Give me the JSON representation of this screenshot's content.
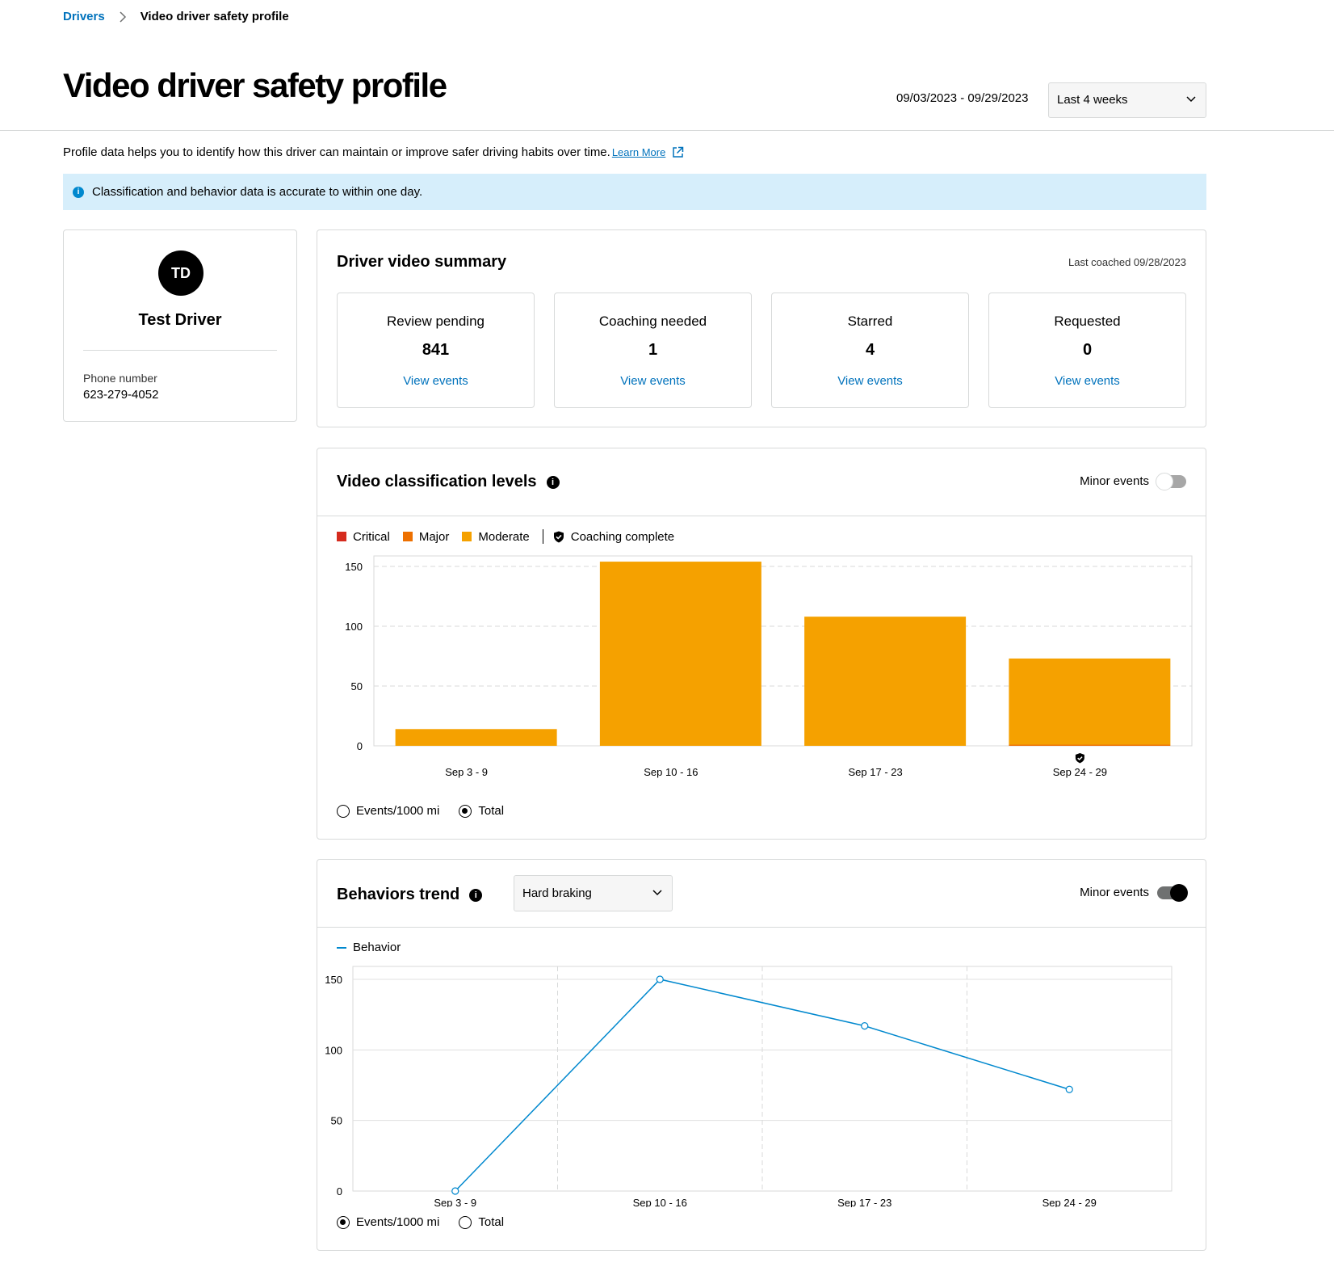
{
  "breadcrumb": {
    "parent": "Drivers",
    "current": "Video driver safety profile"
  },
  "header": {
    "title": "Video driver safety profile",
    "date_range": "09/03/2023 - 09/29/2023",
    "range_select": "Last 4 weeks"
  },
  "description": {
    "text": "Profile data helps you to identify how this driver can maintain or improve safer driving habits over time.",
    "link": "Learn More"
  },
  "banner": {
    "text": "Classification and behavior data is accurate to within one day."
  },
  "driver": {
    "initials": "TD",
    "name": "Test Driver",
    "phone_label": "Phone number",
    "phone": "623-279-4052"
  },
  "summary": {
    "title": "Driver video summary",
    "last_coached": "Last coached 09/28/2023",
    "tiles": [
      {
        "label": "Review pending",
        "value": "841",
        "link": "View events"
      },
      {
        "label": "Coaching needed",
        "value": "1",
        "link": "View events"
      },
      {
        "label": "Starred",
        "value": "4",
        "link": "View events"
      },
      {
        "label": "Requested",
        "value": "0",
        "link": "View events"
      }
    ]
  },
  "classification": {
    "title": "Video classification levels",
    "minor_label": "Minor events",
    "minor_on": false,
    "legend": [
      {
        "label": "Critical",
        "color": "#d52b1e"
      },
      {
        "label": "Major",
        "color": "#ed7000"
      },
      {
        "label": "Moderate",
        "color": "#f5a100"
      }
    ],
    "coaching_label": "Coaching complete",
    "radios": [
      {
        "label": "Events/1000 mi",
        "checked": false
      },
      {
        "label": "Total",
        "checked": true
      }
    ]
  },
  "behaviors": {
    "title": "Behaviors trend",
    "select": "Hard braking",
    "minor_label": "Minor events",
    "minor_on": true,
    "legend_label": "Behavior",
    "radios": [
      {
        "label": "Events/1000 mi",
        "checked": true
      },
      {
        "label": "Total",
        "checked": false
      }
    ]
  },
  "chart_data": [
    {
      "type": "bar",
      "title": "Video classification levels",
      "categories": [
        "Sep 3 - 9",
        "Sep 10 - 16",
        "Sep 17 - 23",
        "Sep 24 - 29"
      ],
      "series": [
        {
          "name": "Critical",
          "color": "#d52b1e",
          "values": [
            0,
            0,
            0,
            0
          ]
        },
        {
          "name": "Major",
          "color": "#ed7000",
          "values": [
            0,
            0,
            0,
            1
          ]
        },
        {
          "name": "Moderate",
          "color": "#f5a100",
          "values": [
            14,
            154,
            108,
            72
          ]
        }
      ],
      "coaching_complete": [
        false,
        false,
        false,
        true
      ],
      "ylim": [
        0,
        150
      ],
      "yticks": [
        0,
        50,
        100,
        150
      ],
      "grid": true
    },
    {
      "type": "line",
      "title": "Behaviors trend",
      "categories": [
        "Sep 3 - 9",
        "Sep 10 - 16",
        "Sep 17 - 23",
        "Sep 24 - 29"
      ],
      "series": [
        {
          "name": "Behavior",
          "color": "#0088ce",
          "values": [
            0,
            150,
            117,
            72
          ]
        }
      ],
      "ylim": [
        0,
        150
      ],
      "yticks": [
        0,
        50,
        100,
        150
      ],
      "grid": true
    }
  ]
}
